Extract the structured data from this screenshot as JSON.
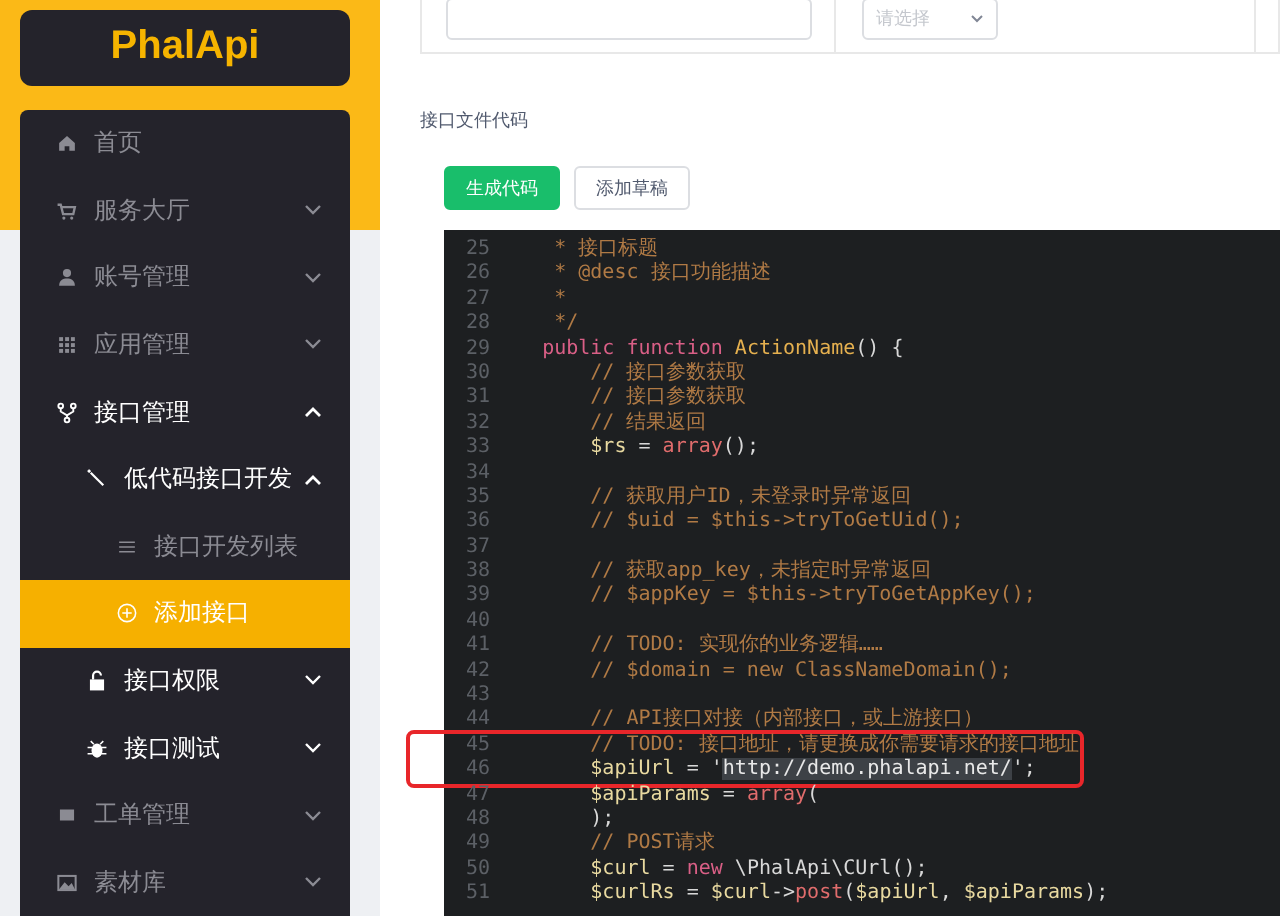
{
  "sidebar": {
    "logo": "PhalApi",
    "nav": [
      {
        "label": "首页",
        "selected": false
      },
      {
        "label": "服务大厅",
        "expanded": false,
        "selected": false
      },
      {
        "label": "账号管理",
        "expanded": false,
        "selected": false
      },
      {
        "label": "应用管理",
        "expanded": false,
        "selected": false
      },
      {
        "label": "接口管理",
        "expanded": true,
        "selected": false,
        "children": [
          {
            "label": "低代码接口开发",
            "expanded": true,
            "selected": false,
            "children": [
              {
                "label": "接口开发列表",
                "selected": false
              },
              {
                "label": "添加接口",
                "selected": true
              }
            ]
          },
          {
            "label": "接口权限",
            "expanded": false,
            "selected": false
          },
          {
            "label": "接口测试",
            "expanded": false,
            "selected": false
          }
        ]
      },
      {
        "label": "工单管理",
        "expanded": false,
        "selected": false
      },
      {
        "label": "素材库",
        "expanded": false,
        "selected": false
      }
    ]
  },
  "main": {
    "select": {
      "placeholder": "请选择"
    },
    "section_label": "接口文件代码",
    "buttons": [
      {
        "label": "生成代码",
        "kind": "primary"
      },
      {
        "label": "添加草稿",
        "kind": "default"
      }
    ],
    "code": [
      {
        "number": "25",
        "segments": [
          {
            "kind": "comment",
            "text": "     * 接口标题"
          }
        ]
      },
      {
        "number": "26",
        "segments": [
          {
            "kind": "comment",
            "text": "     * @desc 接口功能描述"
          }
        ]
      },
      {
        "number": "27",
        "segments": [
          {
            "kind": "comment",
            "text": "     *"
          }
        ]
      },
      {
        "number": "28",
        "segments": [
          {
            "kind": "comment",
            "text": "     */"
          }
        ]
      },
      {
        "number": "29",
        "segments": [
          {
            "kind": "keyword",
            "text": "    public function "
          },
          {
            "kind": "func",
            "text": "ActionName"
          },
          {
            "kind": "plain",
            "text": "() {"
          }
        ]
      },
      {
        "number": "30",
        "segments": [
          {
            "kind": "comment",
            "text": "        // 接口参数获取"
          }
        ]
      },
      {
        "number": "31",
        "segments": [
          {
            "kind": "comment",
            "text": "        // 接口参数获取"
          }
        ]
      },
      {
        "number": "32",
        "segments": [
          {
            "kind": "comment",
            "text": "        // 结果返回"
          }
        ]
      },
      {
        "number": "33",
        "segments": [
          {
            "kind": "var",
            "text": "        $rs"
          },
          {
            "kind": "plain",
            "text": " = "
          },
          {
            "kind": "builtin",
            "text": "array"
          },
          {
            "kind": "plain",
            "text": "();"
          }
        ]
      },
      {
        "number": "34"
      },
      {
        "number": "35",
        "segments": [
          {
            "kind": "comment",
            "text": "        // 获取用户ID，未登录时异常返回"
          }
        ]
      },
      {
        "number": "36",
        "segments": [
          {
            "kind": "comment",
            "text": "        // $uid = $this->tryToGetUid();"
          }
        ]
      },
      {
        "number": "37"
      },
      {
        "number": "38",
        "segments": [
          {
            "kind": "comment",
            "text": "        // 获取app_key，未指定时异常返回"
          }
        ]
      },
      {
        "number": "39",
        "segments": [
          {
            "kind": "comment",
            "text": "        // $appKey = $this->tryToGetAppKey();"
          }
        ]
      },
      {
        "number": "40"
      },
      {
        "number": "41",
        "segments": [
          {
            "kind": "comment",
            "text": "        // TODO: 实现你的业务逻辑……"
          }
        ]
      },
      {
        "number": "42",
        "segments": [
          {
            "kind": "comment",
            "text": "        // $domain = new ClassNameDomain();"
          }
        ]
      },
      {
        "number": "43"
      },
      {
        "number": "44",
        "segments": [
          {
            "kind": "comment",
            "text": "        // API接口对接（内部接口，或上游接口）"
          }
        ]
      },
      {
        "number": "45",
        "highlighted": true,
        "segments": [
          {
            "kind": "comment",
            "text": "        // TODO: 接口地址，请更换成你需要请求的接口地址"
          }
        ]
      },
      {
        "number": "46",
        "highlighted": true,
        "segments": [
          {
            "kind": "var",
            "text": "        $apiUrl"
          },
          {
            "kind": "plain",
            "text": " = '"
          },
          {
            "kind": "selected",
            "text": "http://demo.phalapi.net/"
          },
          {
            "kind": "plain",
            "text": "';"
          }
        ]
      },
      {
        "number": "47",
        "segments": [
          {
            "kind": "var",
            "text": "        $apiParams"
          },
          {
            "kind": "plain",
            "text": " = "
          },
          {
            "kind": "builtin",
            "text": "array"
          },
          {
            "kind": "plain",
            "text": "("
          }
        ]
      },
      {
        "number": "48",
        "segments": [
          {
            "kind": "plain",
            "text": "        );"
          }
        ]
      },
      {
        "number": "49",
        "segments": [
          {
            "kind": "comment",
            "text": "        // POST请求"
          }
        ]
      },
      {
        "number": "50",
        "segments": [
          {
            "kind": "var",
            "text": "        $curl"
          },
          {
            "kind": "plain",
            "text": " = "
          },
          {
            "kind": "keyword",
            "text": "new"
          },
          {
            "kind": "plain",
            "text": " \\PhalApi\\CUrl();"
          }
        ]
      },
      {
        "number": "51",
        "segments": [
          {
            "kind": "var",
            "text": "        $curlRs"
          },
          {
            "kind": "plain",
            "text": " = "
          },
          {
            "kind": "var",
            "text": "$curl"
          },
          {
            "kind": "plain",
            "text": "->"
          },
          {
            "kind": "builtin",
            "text": "post"
          },
          {
            "kind": "plain",
            "text": "("
          },
          {
            "kind": "var",
            "text": "$apiUrl"
          },
          {
            "kind": "plain",
            "text": ", "
          },
          {
            "kind": "var",
            "text": "$apiParams"
          },
          {
            "kind": "plain",
            "text": ");"
          }
        ]
      }
    ]
  }
}
